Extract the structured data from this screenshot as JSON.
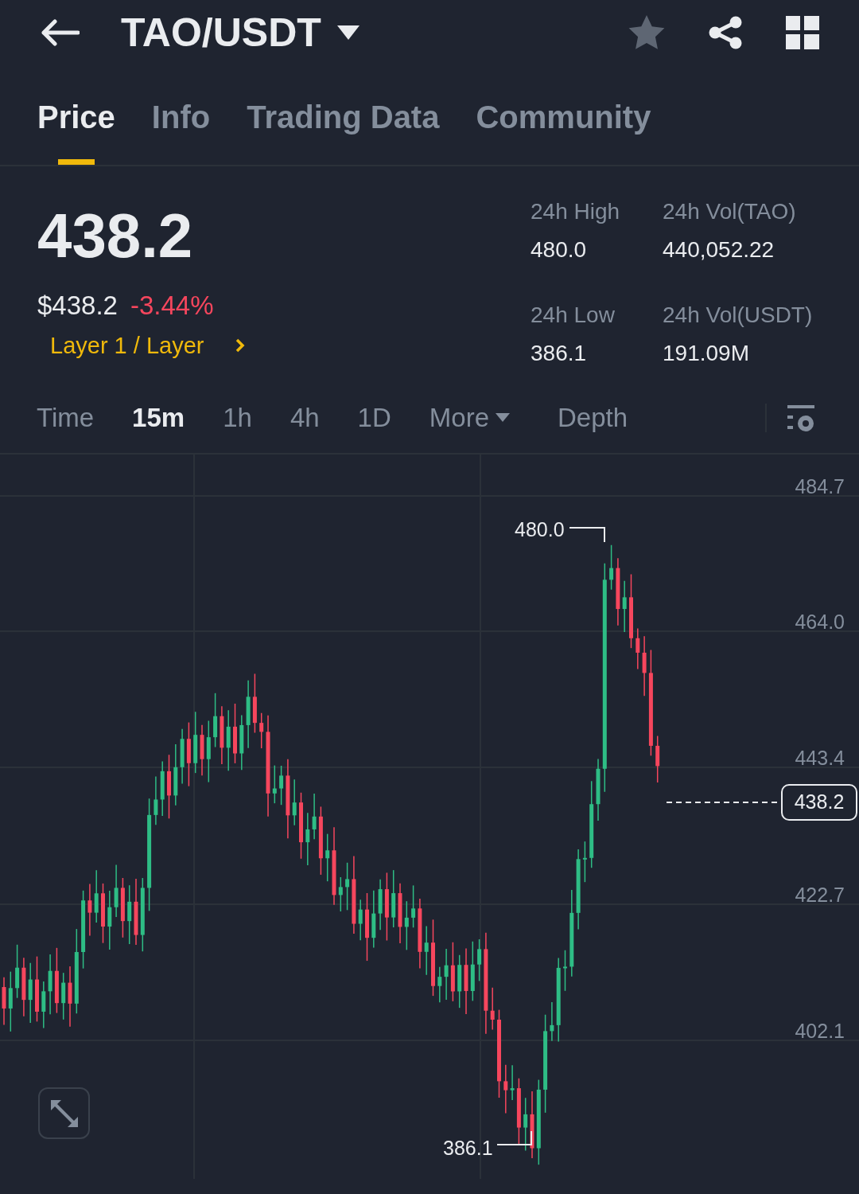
{
  "header": {
    "pair": "TAO/USDT",
    "favorite": false
  },
  "tabs": [
    {
      "label": "Price",
      "selected": true
    },
    {
      "label": "Info",
      "selected": false
    },
    {
      "label": "Trading Data",
      "selected": false
    },
    {
      "label": "Community",
      "selected": false
    }
  ],
  "price": {
    "last": "438.2",
    "usd": "$438.2",
    "change": "-3.44%",
    "category": "Layer 1 / Layer"
  },
  "stats": [
    {
      "label": "24h High",
      "value": "480.0"
    },
    {
      "label": "24h Vol(TAO)",
      "value": "440,052.22"
    },
    {
      "label": "24h Low",
      "value": "386.1"
    },
    {
      "label": "24h Vol(USDT)",
      "value": "191.09M"
    }
  ],
  "intervals": [
    {
      "label": "Time",
      "kind": "option",
      "selected": false
    },
    {
      "label": "15m",
      "kind": "option",
      "selected": true
    },
    {
      "label": "1h",
      "kind": "option",
      "selected": false
    },
    {
      "label": "4h",
      "kind": "option",
      "selected": false
    },
    {
      "label": "1D",
      "kind": "option",
      "selected": false
    },
    {
      "label": "More",
      "kind": "dropdown",
      "selected": false
    },
    {
      "label": "Depth",
      "kind": "option",
      "selected": false
    }
  ],
  "chart": {
    "y_labels": [
      "484.7",
      "464.0",
      "443.4",
      "422.7",
      "402.1"
    ],
    "high_label": "480.0",
    "low_label": "386.1",
    "last_price": "438.2"
  }
}
